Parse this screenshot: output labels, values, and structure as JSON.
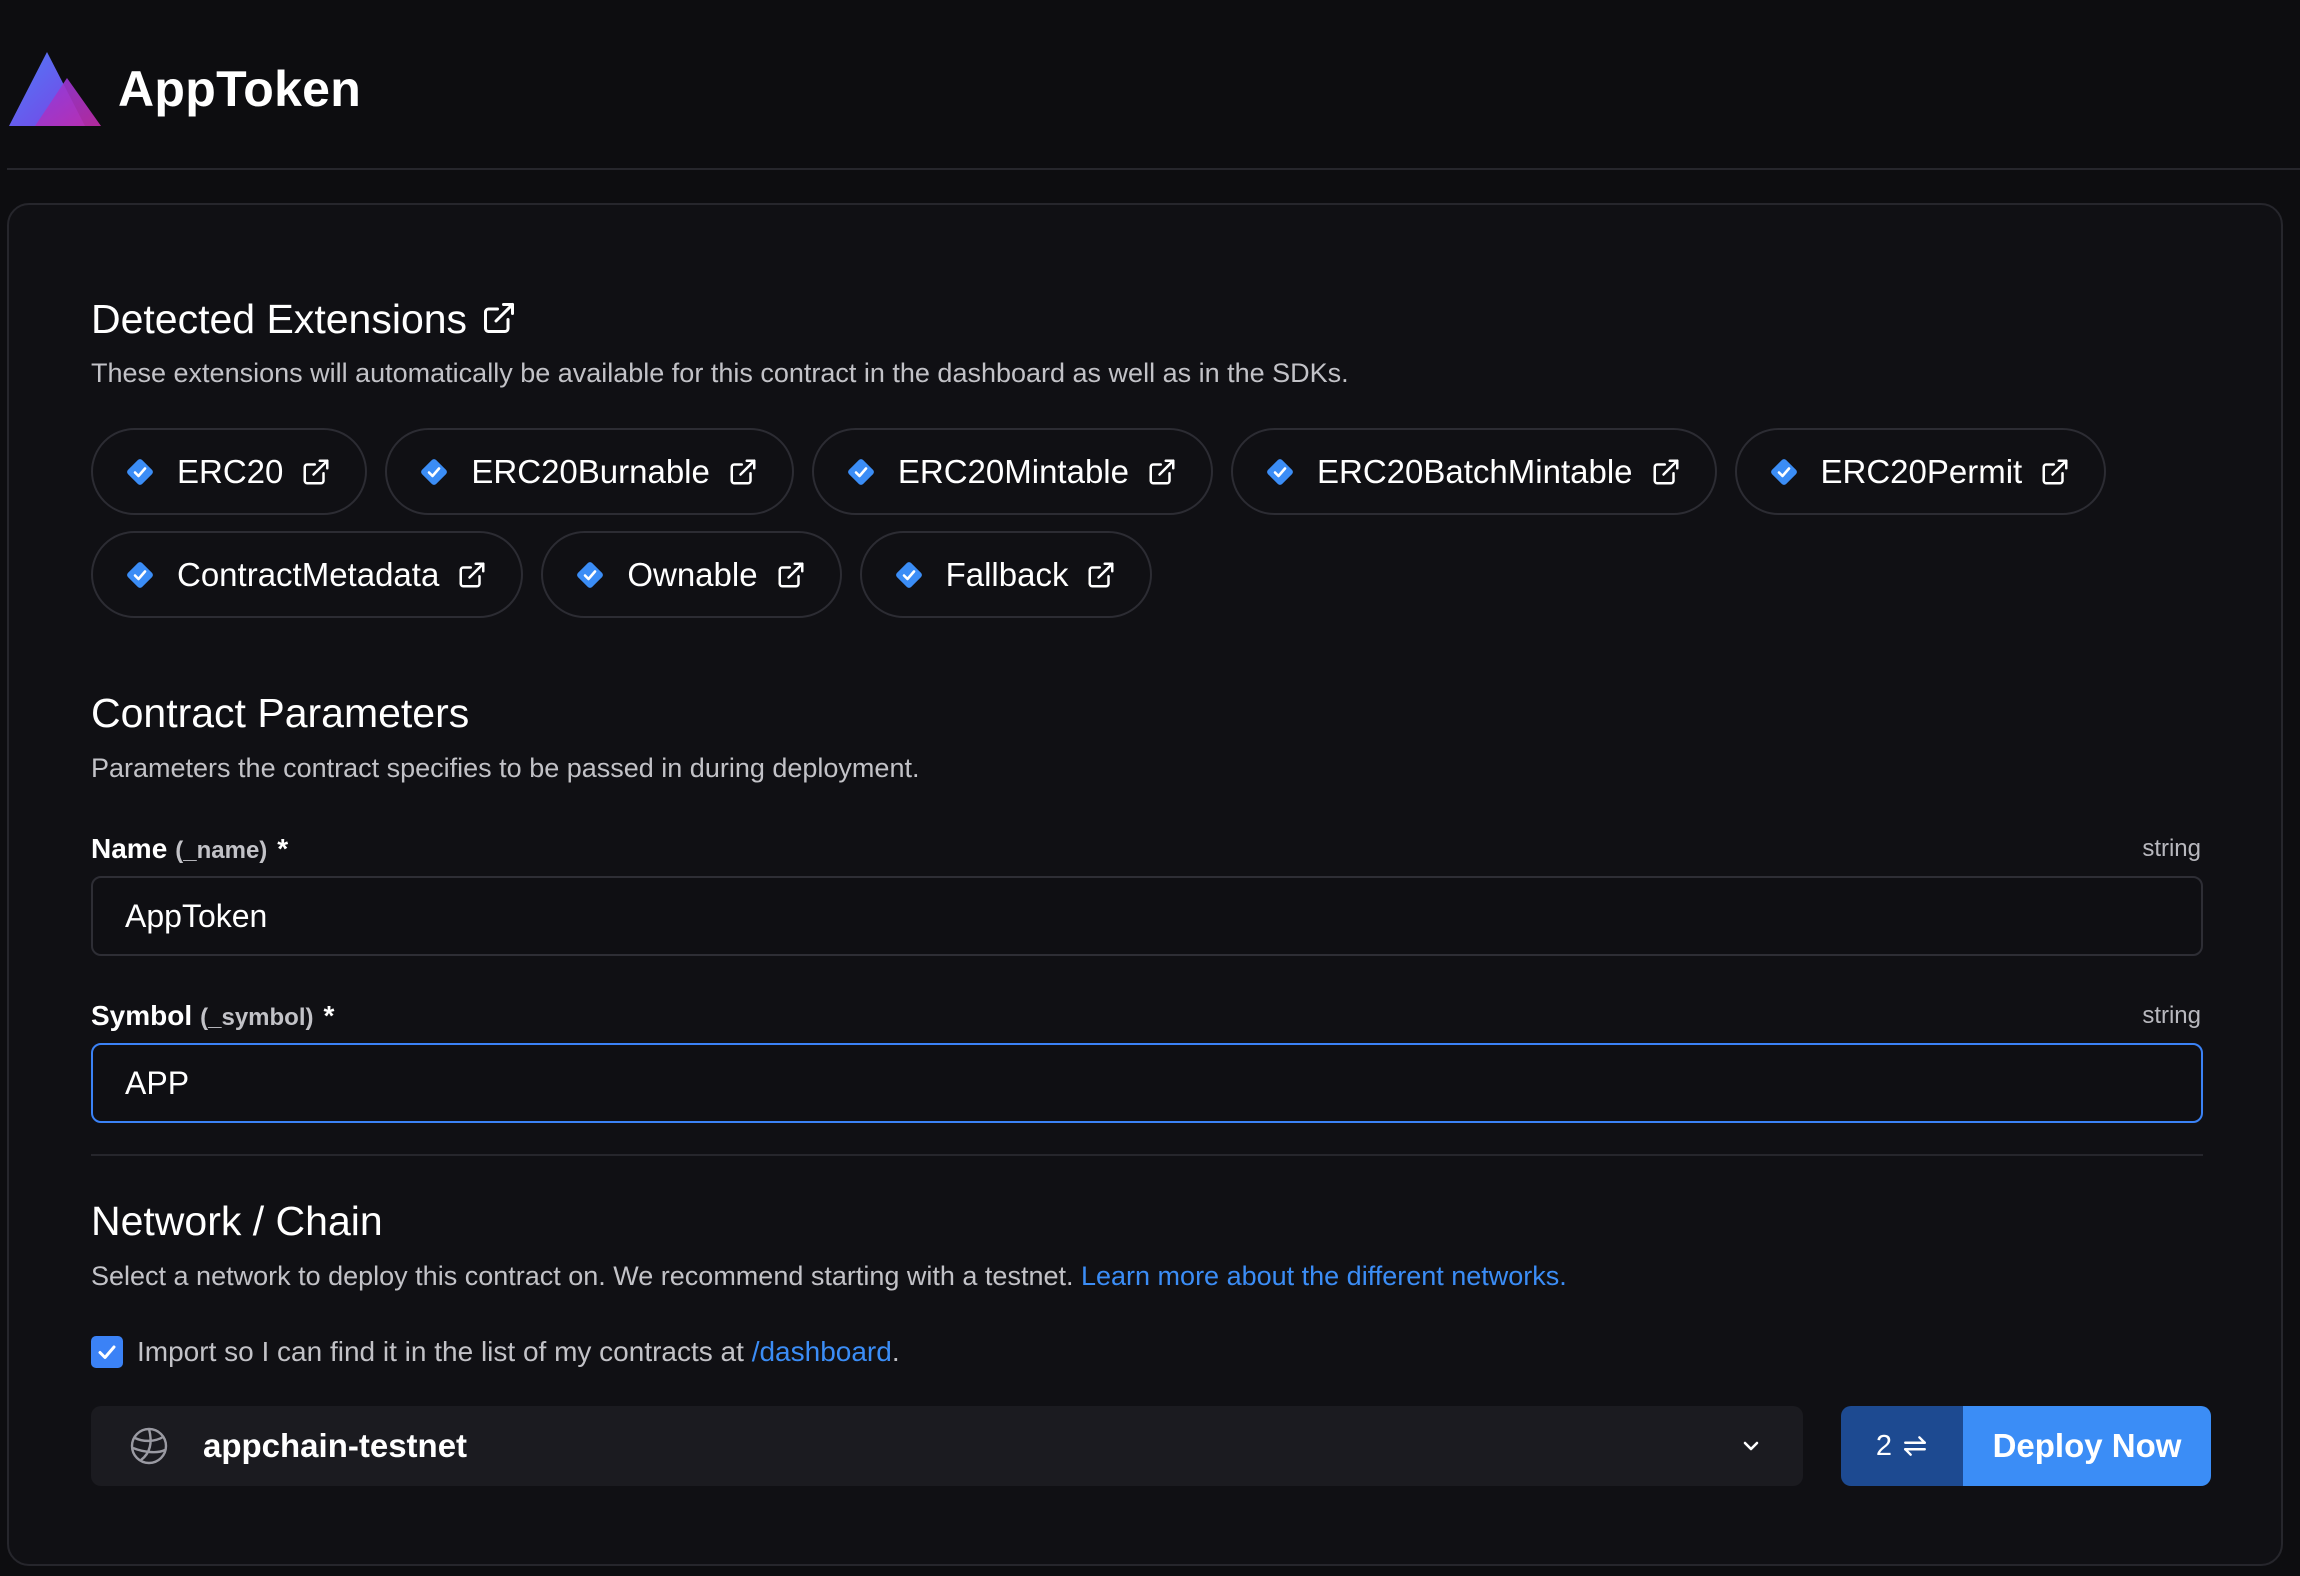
{
  "header": {
    "app_title": "AppToken"
  },
  "extensions": {
    "title": "Detected Extensions",
    "description": "These extensions will automatically be available for this contract in the dashboard as well as in the SDKs.",
    "row1": [
      "ERC20",
      "ERC20Burnable",
      "ERC20Mintable",
      "ERC20BatchMintable",
      "ERC20Permit"
    ],
    "row2": [
      "ContractMetadata",
      "Ownable",
      "Fallback"
    ]
  },
  "params": {
    "title": "Contract Parameters",
    "description": "Parameters the contract specifies to be passed in during deployment.",
    "name_field": {
      "label": "Name",
      "param": "(_name)",
      "required": "*",
      "type": "string",
      "value": "AppToken"
    },
    "symbol_field": {
      "label": "Symbol",
      "param": "(_symbol)",
      "required": "*",
      "type": "string",
      "value": "APP"
    }
  },
  "network": {
    "title": "Network / Chain",
    "description": "Select a network to deploy this contract on. We recommend starting with a testnet.",
    "learn_more_link": "Learn more about the different networks.",
    "import_text": "Import so I can find it in the list of my contracts at",
    "dashboard_link": "/dashboard",
    "import_suffix": ".",
    "import_checked": true,
    "selected_network": "appchain-testnet"
  },
  "deploy": {
    "count": "2",
    "button_label": "Deploy Now"
  },
  "colors": {
    "accent": "#3b8df6",
    "background": "#0d0d10",
    "card": "#101014",
    "count_bg": "#1d4a91"
  }
}
